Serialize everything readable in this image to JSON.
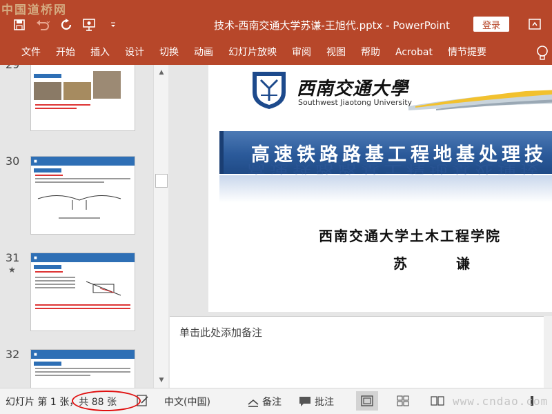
{
  "watermark_top": "中国道桥网",
  "watermark_bottom": "www.cndao.com",
  "window": {
    "title": "技术-西南交通大学苏谦-王旭代.pptx  -  PowerPoint",
    "login": "登录"
  },
  "tabs": [
    "文件",
    "开始",
    "插入",
    "设计",
    "切换",
    "动画",
    "幻灯片放映",
    "审阅",
    "视图",
    "帮助",
    "Acrobat",
    "情节提要"
  ],
  "thumbnails": {
    "numbers": [
      "29",
      "30",
      "31",
      "32"
    ],
    "star": "★"
  },
  "slide": {
    "university_cn": "西南交通大學",
    "university_en": "Southwest Jiaotong University",
    "title": "高速铁路路基工程地基处理技",
    "school": "西南交通大学土木工程学院",
    "author": "苏  谦"
  },
  "notes": {
    "placeholder": "单击此处添加备注"
  },
  "statusbar": {
    "slide_info": "幻灯片 第 1 张，共 88 张",
    "language": "中文(中国)",
    "notes_btn": "备注",
    "comments_btn": "批注"
  },
  "colors": {
    "accent": "#b7472a",
    "banner": "#2b5a9a",
    "highlight_circle": "#e01010"
  }
}
